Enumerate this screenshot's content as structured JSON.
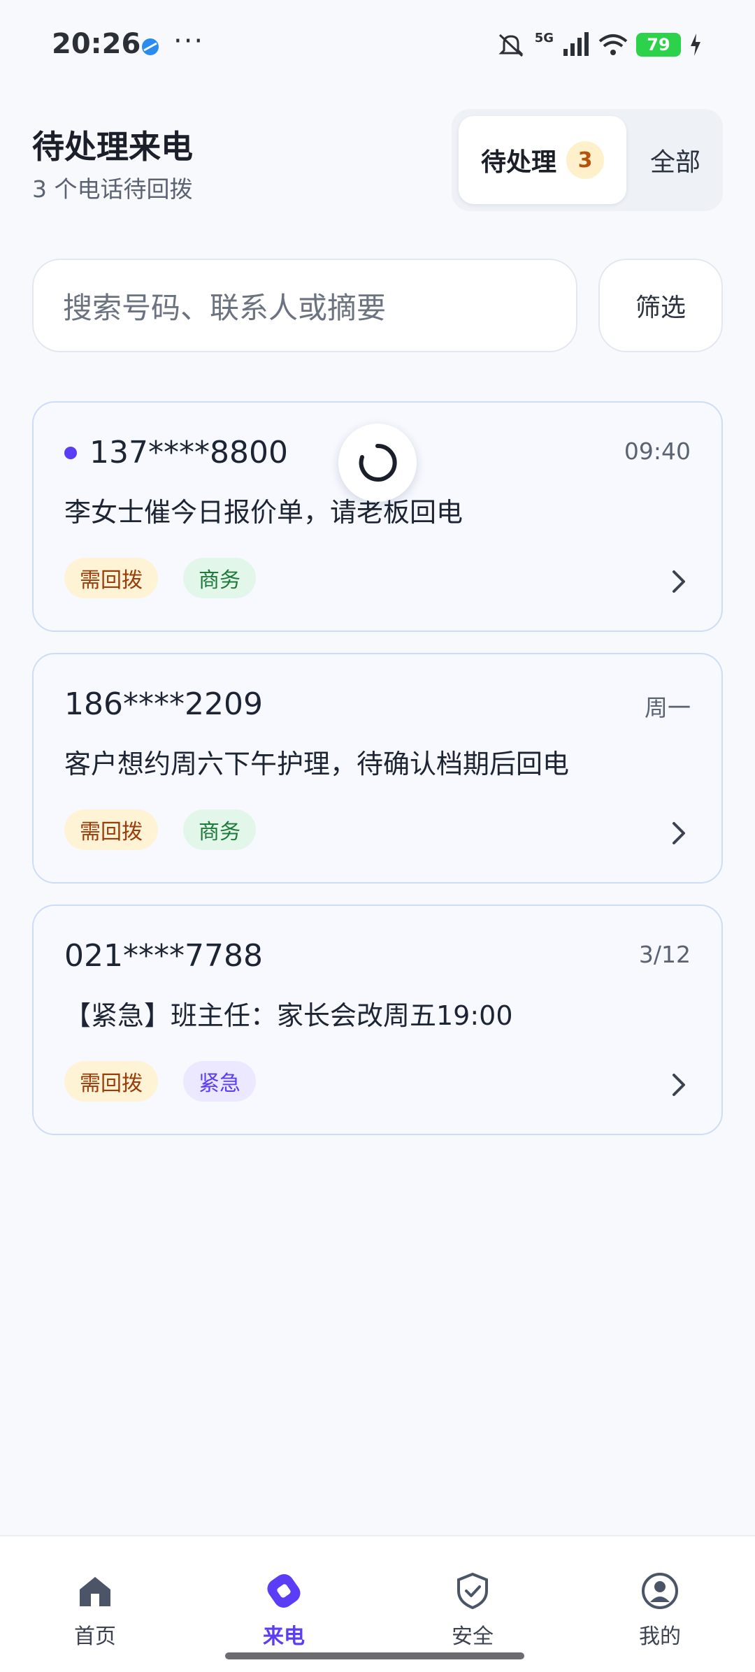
{
  "status_bar": {
    "time": "20:26",
    "more": "···",
    "network": "5G",
    "battery": "79"
  },
  "header": {
    "title": "待处理来电",
    "subtitle": "3 个电话待回拨",
    "segments": {
      "pending_label": "待处理",
      "pending_count": "3",
      "all_label": "全部"
    }
  },
  "search": {
    "placeholder": "搜索号码、联系人或摘要",
    "filter_label": "筛选"
  },
  "calls": [
    {
      "number": "137****8800",
      "time": "09:40",
      "summary": "李女士催今日报价单，请老板回电",
      "tags": [
        "需回拨",
        "商务"
      ],
      "unread": true
    },
    {
      "number": "186****2209",
      "time": "周一",
      "summary": "客户想约周六下午护理，待确认档期后回电",
      "tags": [
        "需回拨",
        "商务"
      ],
      "unread": false
    },
    {
      "number": "021****7788",
      "time": "3/12",
      "summary": "【紧急】班主任：家长会改周五19:00",
      "tags": [
        "需回拨",
        "紧急"
      ],
      "unread": false
    }
  ],
  "nav": {
    "home": "首页",
    "calls": "来电",
    "security": "安全",
    "me": "我的",
    "active": "calls"
  },
  "colors": {
    "accent": "#5b3df5",
    "battery": "#2bd24a",
    "card_border": "#cfdcf6"
  }
}
